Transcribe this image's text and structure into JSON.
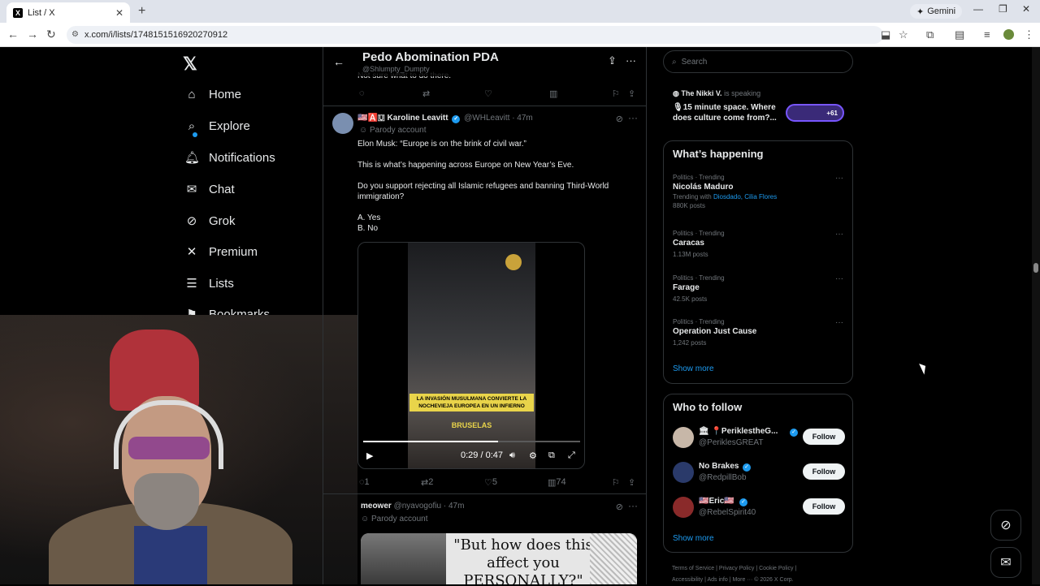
{
  "browser": {
    "tab_title": "List / X",
    "tab_favicon": "X",
    "new_tab": "+",
    "gemini_label": "Gemini",
    "url": "x.com/i/lists/1748151516920270912"
  },
  "nav": {
    "items": [
      {
        "label": "Home",
        "icon": "home-icon"
      },
      {
        "label": "Explore",
        "icon": "search-icon"
      },
      {
        "label": "Notifications",
        "icon": "bell-icon"
      },
      {
        "label": "Chat",
        "icon": "mail-icon"
      },
      {
        "label": "Grok",
        "icon": "grok-icon"
      },
      {
        "label": "Premium",
        "icon": "x-icon"
      },
      {
        "label": "Lists",
        "icon": "list-icon"
      },
      {
        "label": "Bookmarks",
        "icon": "bookmark-icon"
      }
    ]
  },
  "list": {
    "title": "Pedo Abomination PDA",
    "owner": "@Shlumpty_Dumpty"
  },
  "prev_tweet": {
    "text_fragment": "Not sure what to do there."
  },
  "tweet1": {
    "name": "Karoline Leavitt",
    "handle": "@WHLeavitt",
    "time": "· 47m",
    "name_prefix": "🇺🇸🅰️🇺",
    "parody": "Parody account",
    "line1": "Elon Musk: “Europe is on the brink of civil war.”",
    "line2": "This is what’s happening across Europe on New Year’s Eve.",
    "line3": "Do you support rejecting all Islamic refugees and banning Third-World immigration?",
    "line4": "A. Yes",
    "line5": "B. No",
    "video_banner": "LA INVASIÓN MUSULMANA CONVIERTE LA NOCHEVIEJA EUROPEA EN UN INFIERNO",
    "video_city": "BRUSELAS",
    "video_time": "0:29 / 0:47",
    "video_progress": 0.62,
    "replies": "1",
    "reposts": "2",
    "likes": "5",
    "views": "74"
  },
  "tweet2": {
    "name": "meower",
    "handle": "@nyavogofiu",
    "time": "· 47m",
    "parody": "Parody account",
    "meme_text": "\"But how does this affect you PERSONALLY?\""
  },
  "right": {
    "search_placeholder": "Search",
    "space_host": "The Nikki V.",
    "space_status": "is speaking",
    "space_title": "15 minute space. Where does culture come from?...",
    "space_count": "+61",
    "happening_title": "What’s happening",
    "trends": [
      {
        "category": "Politics · Trending",
        "title": "Nicolás Maduro",
        "with_label": "Trending with",
        "with_links": "Diosdado, Cilia Flores",
        "count": "880K posts"
      },
      {
        "category": "Politics · Trending",
        "title": "Caracas",
        "count": "1.13M posts"
      },
      {
        "category": "Politics · Trending",
        "title": "Farage",
        "count": "42.5K posts"
      },
      {
        "category": "Politics · Trending",
        "title": "Operation Just Cause",
        "count": "1,242 posts"
      }
    ],
    "show_more": "Show more",
    "wtf_title": "Who to follow",
    "follow": [
      {
        "name": "🏛 📍PeriklestheG...",
        "handle": "@PeriklesGREAT",
        "button": "Follow"
      },
      {
        "name": "No Brakes",
        "handle": "@RedpillBob",
        "button": "Follow"
      },
      {
        "name": "🇺🇸Eric🇺🇸",
        "handle": "@RebelSpirit40",
        "button": "Follow"
      }
    ],
    "wtf_show_more": "Show more",
    "footer_line1": "Terms of Service  |  Privacy Policy  |  Cookie Policy  |",
    "footer_line2": "Accessibility  |  Ads info  |  More ···  © 2026 X Corp."
  },
  "colors": {
    "accent": "#1d9bf0",
    "background": "#000000",
    "border": "#2f3336",
    "muted": "#71767b"
  }
}
